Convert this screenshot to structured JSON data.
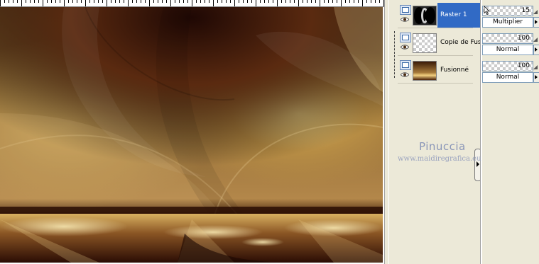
{
  "layers": [
    {
      "name": "Raster 1",
      "selected": true,
      "opacity": "15",
      "blend_mode": "Multiplier",
      "thumb": "dark-circles"
    },
    {
      "name": "Copie de Fusionné",
      "selected": false,
      "opacity": "100",
      "blend_mode": "Normal",
      "thumb": "transparent"
    },
    {
      "name": "Fusionné",
      "selected": false,
      "opacity": "100",
      "blend_mode": "Normal",
      "thumb": "gold-landscape"
    }
  ],
  "watermark": {
    "name": "Pinuccia",
    "url": "www.maidiregrafica.eu"
  },
  "colors": {
    "panel": "#ece9d8",
    "selection": "#316ac5",
    "canvas_dark": "#2a1206",
    "canvas_gold": "#e0c070"
  }
}
